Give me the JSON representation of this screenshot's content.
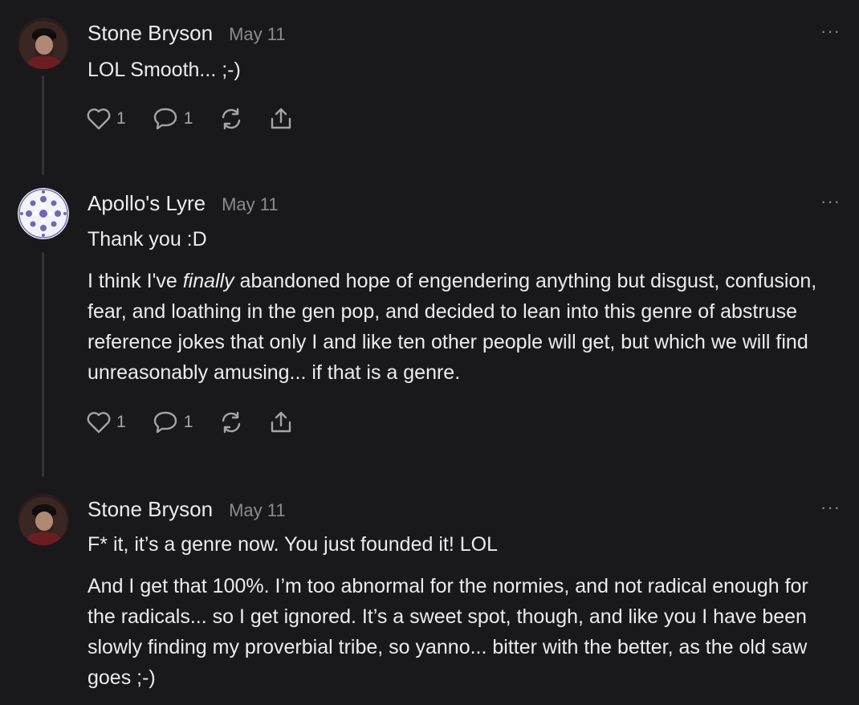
{
  "comments": [
    {
      "author": "Stone Bryson",
      "date": "May 11",
      "more": "···",
      "paragraphs": [
        "LOL Smooth... ;-)"
      ],
      "likes": "1",
      "replies": "1"
    },
    {
      "author": "Apollo's Lyre",
      "date": "May 11",
      "more": "···",
      "paragraphs": [
        "Thank you :D",
        {
          "before": "I think I've ",
          "italic": "finally",
          "after": " abandoned hope of engendering anything but disgust, confusion, fear, and loathing in the gen pop, and decided to lean into this genre of abstruse reference jokes that only I and like ten other people will get, but which we will find unreasonably amusing... if that is a genre."
        }
      ],
      "likes": "1",
      "replies": "1"
    },
    {
      "author": "Stone Bryson",
      "date": "May 11",
      "more": "···",
      "paragraphs": [
        "F* it, it’s a genre now. You just founded it! LOL",
        "And I get that 100%. I’m too abnormal for the normies, and not radical enough for the radicals... so I get ignored. It’s a sweet spot, though, and like you I have been slowly finding my proverbial tribe, so yanno... bitter with the better, as the old saw goes ;-)"
      ]
    }
  ],
  "icons": {
    "like": "heart-icon",
    "reply": "speech-bubble-icon",
    "restack": "restack-icon",
    "share": "share-icon",
    "more": "more-dots-icon"
  }
}
